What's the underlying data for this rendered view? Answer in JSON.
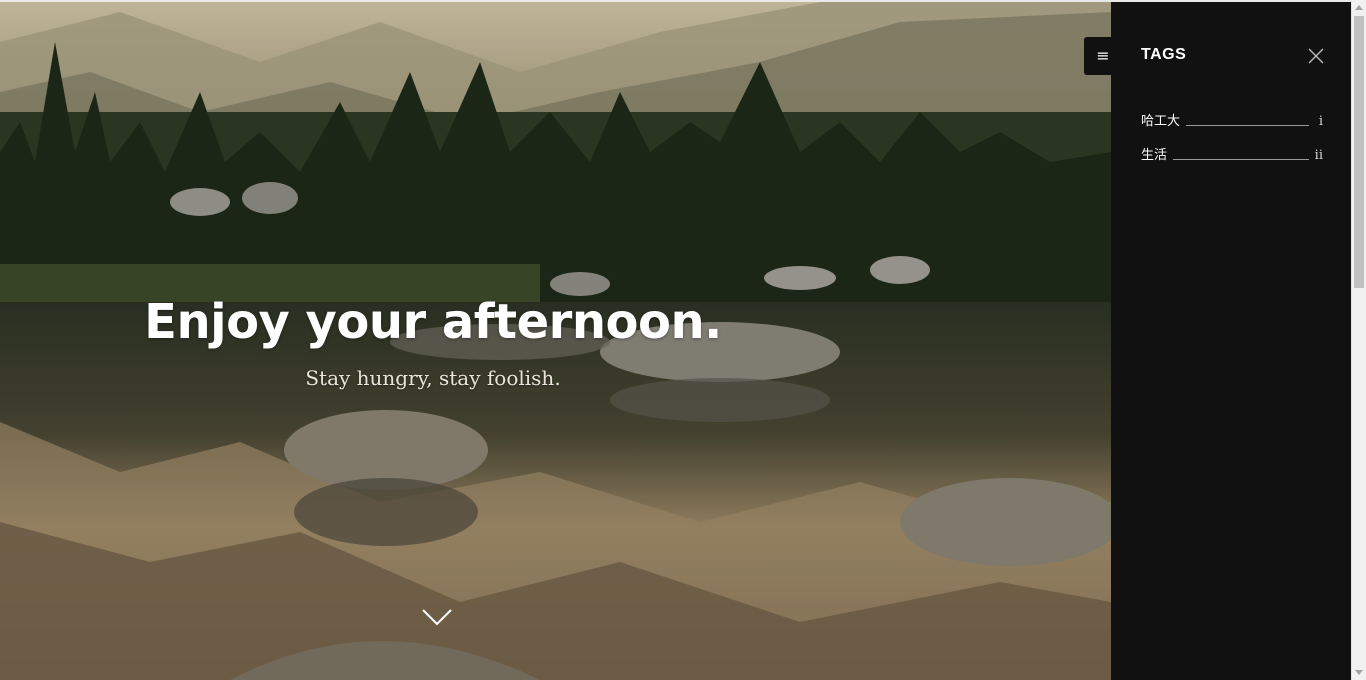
{
  "hero": {
    "title": "Enjoy your afternoon.",
    "subtitle": "Stay hungry, stay foolish.",
    "scroll_icon": "chevron-down-icon"
  },
  "menu": {
    "icon": "hamburger-icon",
    "glyph": "≡"
  },
  "sidebar": {
    "title": "TAGS",
    "close_icon": "close-icon",
    "tags": [
      {
        "label": "哈工大",
        "count": "i"
      },
      {
        "label": "生活",
        "count": "ii"
      }
    ]
  },
  "colors": {
    "sidebar_bg": "#111111",
    "text": "#ffffff",
    "rule": "#9a9a9a"
  }
}
